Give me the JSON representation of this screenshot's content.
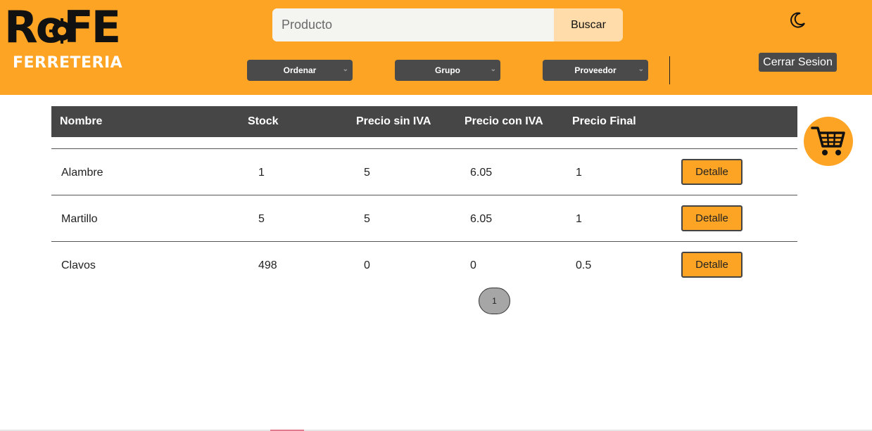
{
  "brand": {
    "logo_top": "RoFE",
    "logo_bottom": "FERRETERIA"
  },
  "search": {
    "placeholder": "Producto",
    "value": "",
    "button_label": "Buscar"
  },
  "filters": {
    "ordenar": "Ordenar",
    "grupo": "Grupo",
    "proveedor": "Proveedor"
  },
  "header_actions": {
    "logout_label": "Cerrar Sesion",
    "theme_icon": "moon-icon"
  },
  "table": {
    "columns": [
      "Nombre",
      "Stock",
      "Precio sin IVA",
      "Precio con IVA",
      "Precio Final"
    ],
    "rows": [
      {
        "nombre": "Alambre",
        "stock": "1",
        "precio_sin_iva": "5",
        "precio_con_iva": "6.05",
        "precio_final": "1",
        "action": "Detalle"
      },
      {
        "nombre": "Martillo",
        "stock": "5",
        "precio_sin_iva": "5",
        "precio_con_iva": "6.05",
        "precio_final": "1",
        "action": "Detalle"
      },
      {
        "nombre": "Clavos",
        "stock": "498",
        "precio_sin_iva": "0",
        "precio_con_iva": "0",
        "precio_final": "0.5",
        "action": "Detalle"
      }
    ]
  },
  "pagination": {
    "current_page": "1"
  },
  "cart": {
    "icon": "cart-icon"
  },
  "colors": {
    "accent": "#fea424",
    "dark": "#464646",
    "search_button": "#ffdcaa"
  }
}
